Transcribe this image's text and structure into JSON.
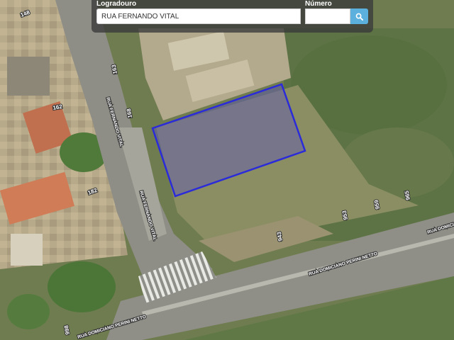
{
  "search": {
    "street_label": "Logradouro",
    "street_value": "RUA FERNANDO VITAL",
    "number_label": "Número",
    "number_value": "",
    "button_icon": "search-icon"
  },
  "map": {
    "street_labels": {
      "fernando_vital_upper": "RUA FERNANDO VITAL",
      "fernando_vital_lower": "RUA FERNANDO VITAL",
      "domiciano_upper": "RUA DOMICIANO PERINI NETTO",
      "domiciano_right": "RUA DOMICI",
      "domiciano_lower": "RUA DOMICIANO PERINI NETTO"
    },
    "house_numbers": {
      "n148": "148",
      "n163": "163",
      "n162": "162",
      "n168": "168",
      "n182": "182",
      "n943": "943",
      "n953": "953",
      "n959": "959",
      "n965": "965",
      "n998": "998"
    },
    "highlight_color": "#2b2bd9"
  }
}
